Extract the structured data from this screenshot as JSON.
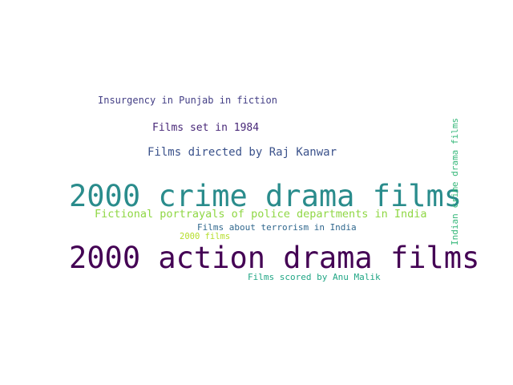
{
  "words": [
    {
      "key": "insurgency",
      "text": "Insurgency in Punjab in fiction",
      "color": "#433e85"
    },
    {
      "key": "set1984",
      "text": "Films set in 1984",
      "color": "#482878"
    },
    {
      "key": "rajkanwar",
      "text": "Films directed by Raj Kanwar",
      "color": "#3b528b"
    },
    {
      "key": "crime",
      "text": "2000 crime drama films",
      "color": "#2a8c8c"
    },
    {
      "key": "fictional",
      "text": "Fictional portrayals of police departments in India",
      "color": "#8fd744"
    },
    {
      "key": "terrorism",
      "text": "Films about terrorism in India",
      "color": "#31688e"
    },
    {
      "key": "films2000",
      "text": "2000 films",
      "color": "#b5de2b"
    },
    {
      "key": "action",
      "text": "2000 action drama films",
      "color": "#440154"
    },
    {
      "key": "anumalik",
      "text": "Films scored by Anu Malik",
      "color": "#21a685"
    },
    {
      "key": "indian",
      "text": "Indian crime drama films",
      "color": "#35b779"
    }
  ]
}
